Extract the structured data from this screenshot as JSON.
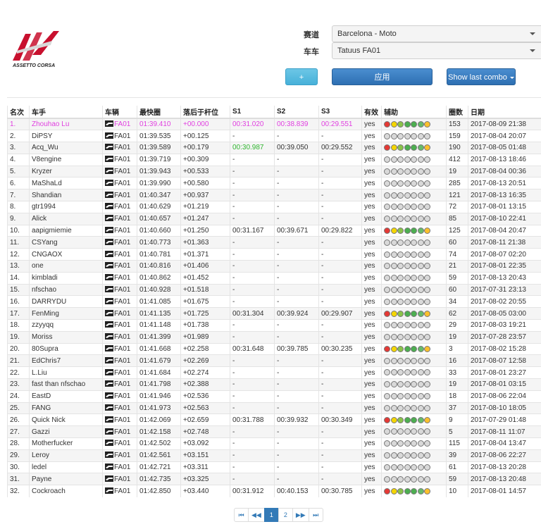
{
  "logo": {
    "text": "ASSETTO CORSA",
    "colors": {
      "red": "#c8102e",
      "dark": "#333333"
    }
  },
  "filters": {
    "track_label": "赛道",
    "track_value": "Barcelona - Moto",
    "car_label": "车车",
    "car_value": "Tatuus FA01"
  },
  "buttons": {
    "add": "+",
    "apply": "应用",
    "combo": "Show last combo"
  },
  "colors": {
    "highlight_pink": "#e040e0",
    "best_sector_green": "#2fb52f",
    "primary": "#337ab7"
  },
  "table": {
    "headers": [
      "名次",
      "车手",
      "车辆",
      "最快圈",
      "落后于杆位",
      "S1",
      "S2",
      "S3",
      "有效",
      "辅助",
      "圈数",
      "日期"
    ],
    "rows": [
      [
        "1.",
        "Zhouhao Lu",
        "FA01",
        "01:39.410",
        "+00.000",
        "00:31.020",
        "00:38.839",
        "00:29.551",
        "yes",
        "153",
        "2017-08-09 21:38"
      ],
      [
        "2.",
        "DiPSY",
        "FA01",
        "01:39.535",
        "+00.125",
        "-",
        "-",
        "-",
        "yes",
        "159",
        "2017-08-04 20:07"
      ],
      [
        "3.",
        "Acq_Wu",
        "FA01",
        "01:39.589",
        "+00.179",
        "00:30.987",
        "00:39.050",
        "00:29.552",
        "yes",
        "190",
        "2017-08-05 01:48"
      ],
      [
        "4.",
        "V8engine",
        "FA01",
        "01:39.719",
        "+00.309",
        "-",
        "-",
        "-",
        "yes",
        "412",
        "2017-08-13 18:46"
      ],
      [
        "5.",
        "Kryzer",
        "FA01",
        "01:39.943",
        "+00.533",
        "-",
        "-",
        "-",
        "yes",
        "19",
        "2017-08-04 00:36"
      ],
      [
        "6.",
        "MaShaLd",
        "FA01",
        "01:39.990",
        "+00.580",
        "-",
        "-",
        "-",
        "yes",
        "285",
        "2017-08-13 20:51"
      ],
      [
        "7.",
        "Shandian",
        "FA01",
        "01:40.347",
        "+00.937",
        "-",
        "-",
        "-",
        "yes",
        "121",
        "2017-08-13 16:35"
      ],
      [
        "8.",
        "gtr1994",
        "FA01",
        "01:40.629",
        "+01.219",
        "-",
        "-",
        "-",
        "yes",
        "72",
        "2017-08-01 13:15"
      ],
      [
        "9.",
        "Alick",
        "FA01",
        "01:40.657",
        "+01.247",
        "-",
        "-",
        "-",
        "yes",
        "85",
        "2017-08-10 22:41"
      ],
      [
        "10.",
        "aapigmiemie",
        "FA01",
        "01:40.660",
        "+01.250",
        "00:31.167",
        "00:39.671",
        "00:29.822",
        "yes",
        "125",
        "2017-08-04 20:47"
      ],
      [
        "11.",
        "CSYang",
        "FA01",
        "01:40.773",
        "+01.363",
        "-",
        "-",
        "-",
        "yes",
        "60",
        "2017-08-11 21:38"
      ],
      [
        "12.",
        "CNGAOX",
        "FA01",
        "01:40.781",
        "+01.371",
        "-",
        "-",
        "-",
        "yes",
        "74",
        "2017-08-07 02:20"
      ],
      [
        "13.",
        "one",
        "FA01",
        "01:40.816",
        "+01.406",
        "-",
        "-",
        "-",
        "yes",
        "21",
        "2017-08-01 22:35"
      ],
      [
        "14.",
        "kimbladi",
        "FA01",
        "01:40.862",
        "+01.452",
        "-",
        "-",
        "-",
        "yes",
        "59",
        "2017-08-13 20:43"
      ],
      [
        "15.",
        "nfschao",
        "FA01",
        "01:40.928",
        "+01.518",
        "-",
        "-",
        "-",
        "yes",
        "60",
        "2017-07-31 23:13"
      ],
      [
        "16.",
        "DARRYDU",
        "FA01",
        "01:41.085",
        "+01.675",
        "-",
        "-",
        "-",
        "yes",
        "34",
        "2017-08-02 20:55"
      ],
      [
        "17.",
        "FenMing",
        "FA01",
        "01:41.135",
        "+01.725",
        "00:31.304",
        "00:39.924",
        "00:29.907",
        "yes",
        "62",
        "2017-08-05 03:00"
      ],
      [
        "18.",
        "zzyyqq",
        "FA01",
        "01:41.148",
        "+01.738",
        "-",
        "-",
        "-",
        "yes",
        "29",
        "2017-08-03 19:21"
      ],
      [
        "19.",
        "Moriss",
        "FA01",
        "01:41.399",
        "+01.989",
        "-",
        "-",
        "-",
        "yes",
        "19",
        "2017-07-28 23:57"
      ],
      [
        "20.",
        "80Supra",
        "FA01",
        "01:41.668",
        "+02.258",
        "00:31.648",
        "00:39.785",
        "00:30.235",
        "yes",
        "3",
        "2017-08-02 15:28"
      ],
      [
        "21.",
        "EdChris7",
        "FA01",
        "01:41.679",
        "+02.269",
        "-",
        "-",
        "-",
        "yes",
        "16",
        "2017-08-07 12:58"
      ],
      [
        "22.",
        "L.Liu",
        "FA01",
        "01:41.684",
        "+02.274",
        "-",
        "-",
        "-",
        "yes",
        "33",
        "2017-08-01 23:27"
      ],
      [
        "23.",
        "fast than nfschao",
        "FA01",
        "01:41.798",
        "+02.388",
        "-",
        "-",
        "-",
        "yes",
        "19",
        "2017-08-01 03:15"
      ],
      [
        "24.",
        "EastD",
        "FA01",
        "01:41.946",
        "+02.536",
        "-",
        "-",
        "-",
        "yes",
        "18",
        "2017-08-06 22:04"
      ],
      [
        "25.",
        "FANG",
        "FA01",
        "01:41.973",
        "+02.563",
        "-",
        "-",
        "-",
        "yes",
        "37",
        "2017-08-10 18:05"
      ],
      [
        "26.",
        "Quick Nick",
        "FA01",
        "01:42.069",
        "+02.659",
        "00:31.788",
        "00:39.932",
        "00:30.349",
        "yes",
        "9",
        "2017-07-29 01:48"
      ],
      [
        "27.",
        "Gazzi",
        "FA01",
        "01:42.158",
        "+02.748",
        "-",
        "-",
        "-",
        "yes",
        "5",
        "2017-08-11 11:07"
      ],
      [
        "28.",
        "Motherfucker",
        "FA01",
        "01:42.502",
        "+03.092",
        "-",
        "-",
        "-",
        "yes",
        "115",
        "2017-08-04 13:47"
      ],
      [
        "29.",
        "Leroy",
        "FA01",
        "01:42.561",
        "+03.151",
        "-",
        "-",
        "-",
        "yes",
        "39",
        "2017-08-06 22:27"
      ],
      [
        "30.",
        "ledel",
        "FA01",
        "01:42.721",
        "+03.311",
        "-",
        "-",
        "-",
        "yes",
        "61",
        "2017-08-13 20:28"
      ],
      [
        "31.",
        "Payne",
        "FA01",
        "01:42.735",
        "+03.325",
        "-",
        "-",
        "-",
        "yes",
        "59",
        "2017-08-13 20:48"
      ],
      [
        "32.",
        "Cockroach",
        "FA01",
        "01:42.850",
        "+03.440",
        "00:31.912",
        "00:40.153",
        "00:30.785",
        "yes",
        "10",
        "2017-08-01 14:57"
      ]
    ],
    "green_cells": [
      [
        0,
        6
      ],
      [
        0,
        7
      ],
      [
        2,
        5
      ]
    ],
    "aid_color_rows": [
      0,
      2,
      9,
      16,
      19,
      25,
      31
    ],
    "aid_icons": [
      "abs-icon",
      "tc-icon",
      "stability-icon",
      "autoclutch-icon",
      "autoshift-icon",
      "idealline-icon",
      "damage-icon"
    ]
  },
  "pagination": {
    "first": "⏮",
    "prev": "◀◀",
    "pages": [
      "1",
      "2"
    ],
    "next": "▶▶",
    "last": "⏭",
    "active": "1"
  }
}
